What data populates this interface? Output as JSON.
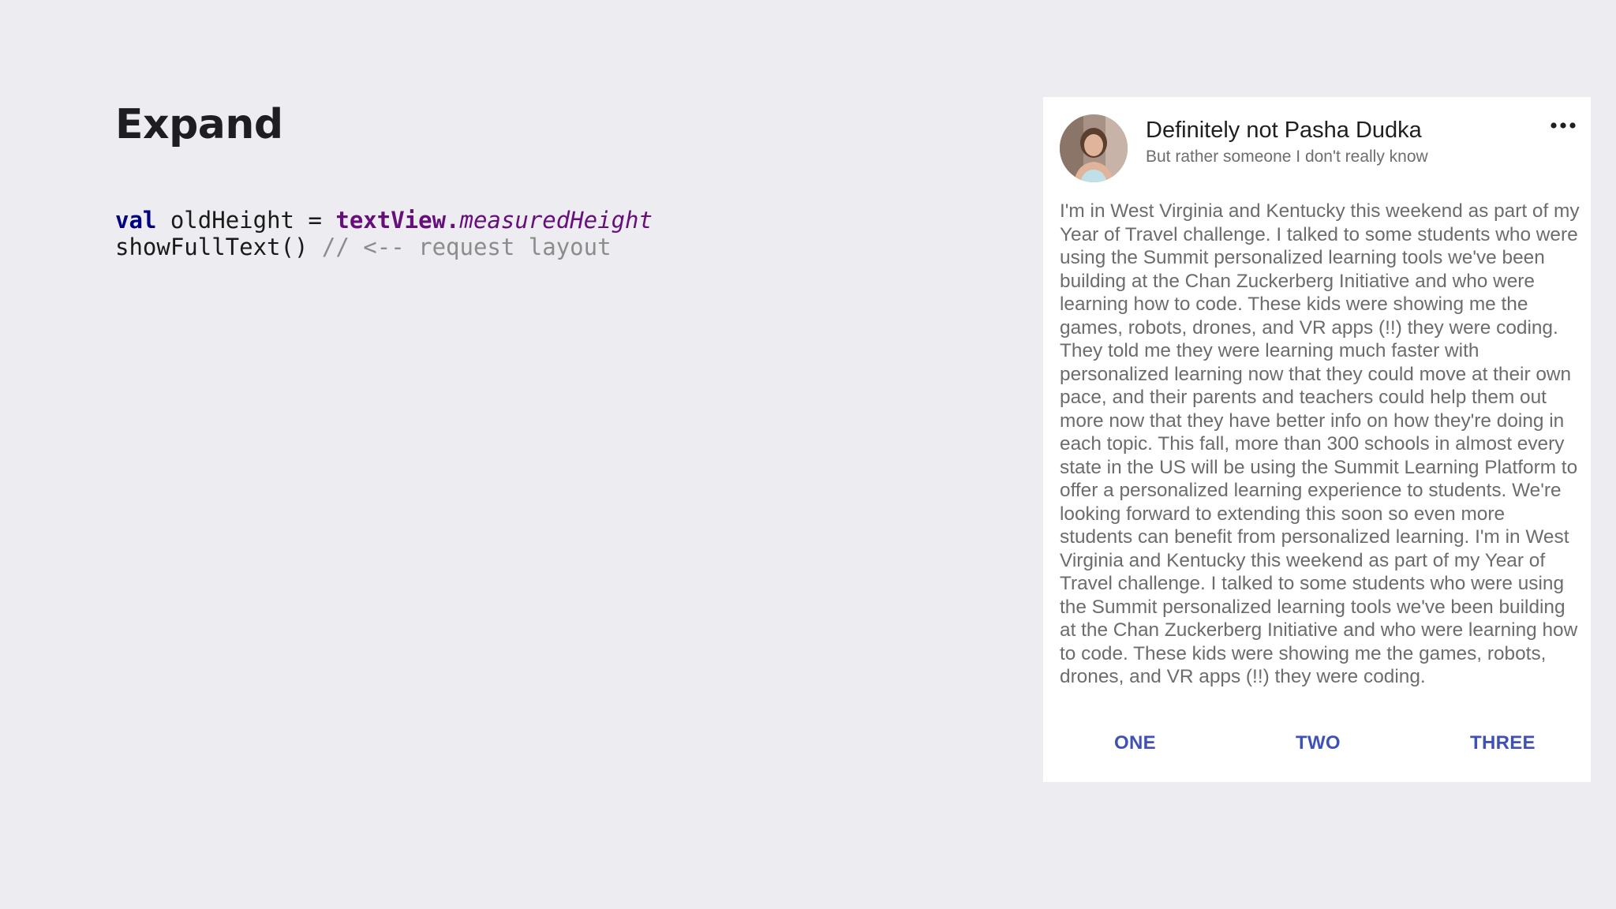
{
  "slide": {
    "title": "Expand"
  },
  "code": {
    "line1": {
      "keyword": "val",
      "variable": " oldHeight = ",
      "receiver": "textView.",
      "property": "measuredHeight"
    },
    "line2": {
      "call": "showFullText() ",
      "comment": "// <-- request layout"
    }
  },
  "card": {
    "author_name": "Definitely not Pasha Dudka",
    "author_subtitle": "But rather someone I don't really know",
    "more_icon": "more-horizontal-icon",
    "avatar": "profile-photo",
    "body": "I'm in West Virginia and Kentucky this weekend as part of my Year of Travel challenge. I talked to some students who were using the Summit personalized learning tools we've been building at the Chan Zuckerberg Initiative and who were learning how to code. These kids were showing me the games, robots, drones, and VR apps (!!) they were coding. They told me they were learning much faster with personalized learning now that they could move at their own pace, and their parents and teachers could help them out more now that they have better info on how they're doing in each topic. This fall, more than 300 schools in almost every state in the US will be using the Summit Learning Platform to offer a personalized learning experience to students. We're looking forward to extending this soon so even more students can benefit from personalized learning. I'm in West Virginia and Kentucky this weekend as part of my Year of Travel challenge. I talked to some students who were using the Summit personalized learning tools we've been building at the Chan Zuckerberg Initiative and who were learning how to code. These kids were showing me the games, robots, drones, and VR apps (!!) they were coding.",
    "actions": [
      "ONE",
      "TWO",
      "THREE"
    ]
  },
  "colors": {
    "background": "#ececf1",
    "keyword": "#000080",
    "reference": "#660e7a",
    "comment": "#8c8c8c",
    "button": "#3f51b5"
  }
}
